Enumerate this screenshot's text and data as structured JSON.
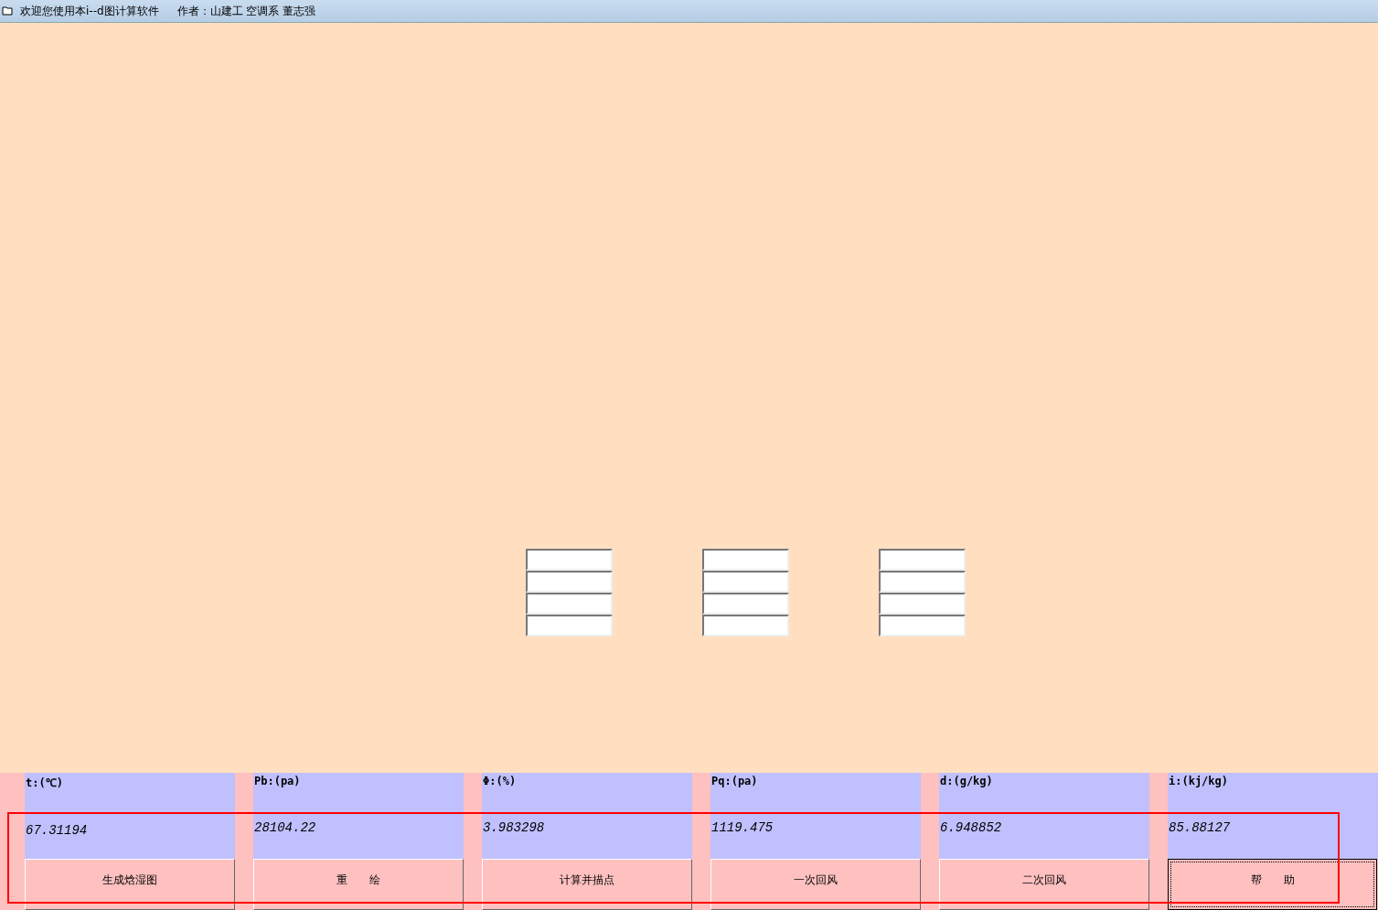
{
  "window": {
    "title": "欢迎您使用本i--d图计算软件",
    "author": "作者：山建工 空调系 董志强"
  },
  "input_groups": [
    {
      "fields": [
        {
          "kind": "text"
        },
        {
          "kind": "text"
        },
        {
          "kind": "text"
        },
        {
          "kind": "text"
        }
      ]
    },
    {
      "fields": [
        {
          "kind": "text"
        },
        {
          "kind": "text"
        },
        {
          "kind": "text"
        },
        {
          "kind": "text"
        }
      ]
    },
    {
      "fields": [
        {
          "kind": "text"
        },
        {
          "kind": "text"
        },
        {
          "kind": "text"
        },
        {
          "kind": "text"
        }
      ]
    }
  ],
  "readouts": [
    {
      "label": "t:(℃)",
      "value": "67.31194",
      "button": "生成焓湿图",
      "focused": false
    },
    {
      "label": "Pb:(pa)",
      "value": "28104.22",
      "button": "重　　绘",
      "focused": false
    },
    {
      "label": "Φ:(%)",
      "value": "3.983298",
      "button": "计算并描点",
      "focused": false
    },
    {
      "label": "Pq:(pa)",
      "value": "1119.475",
      "button": "一次回风",
      "focused": false
    },
    {
      "label": "d:(g/kg)",
      "value": "6.948852",
      "button": "二次回风",
      "focused": false
    },
    {
      "label": "i:(kj/kg)",
      "value": "85.88127",
      "button": "帮　　助",
      "focused": true
    }
  ],
  "highlight": {
    "kind": "frame"
  }
}
